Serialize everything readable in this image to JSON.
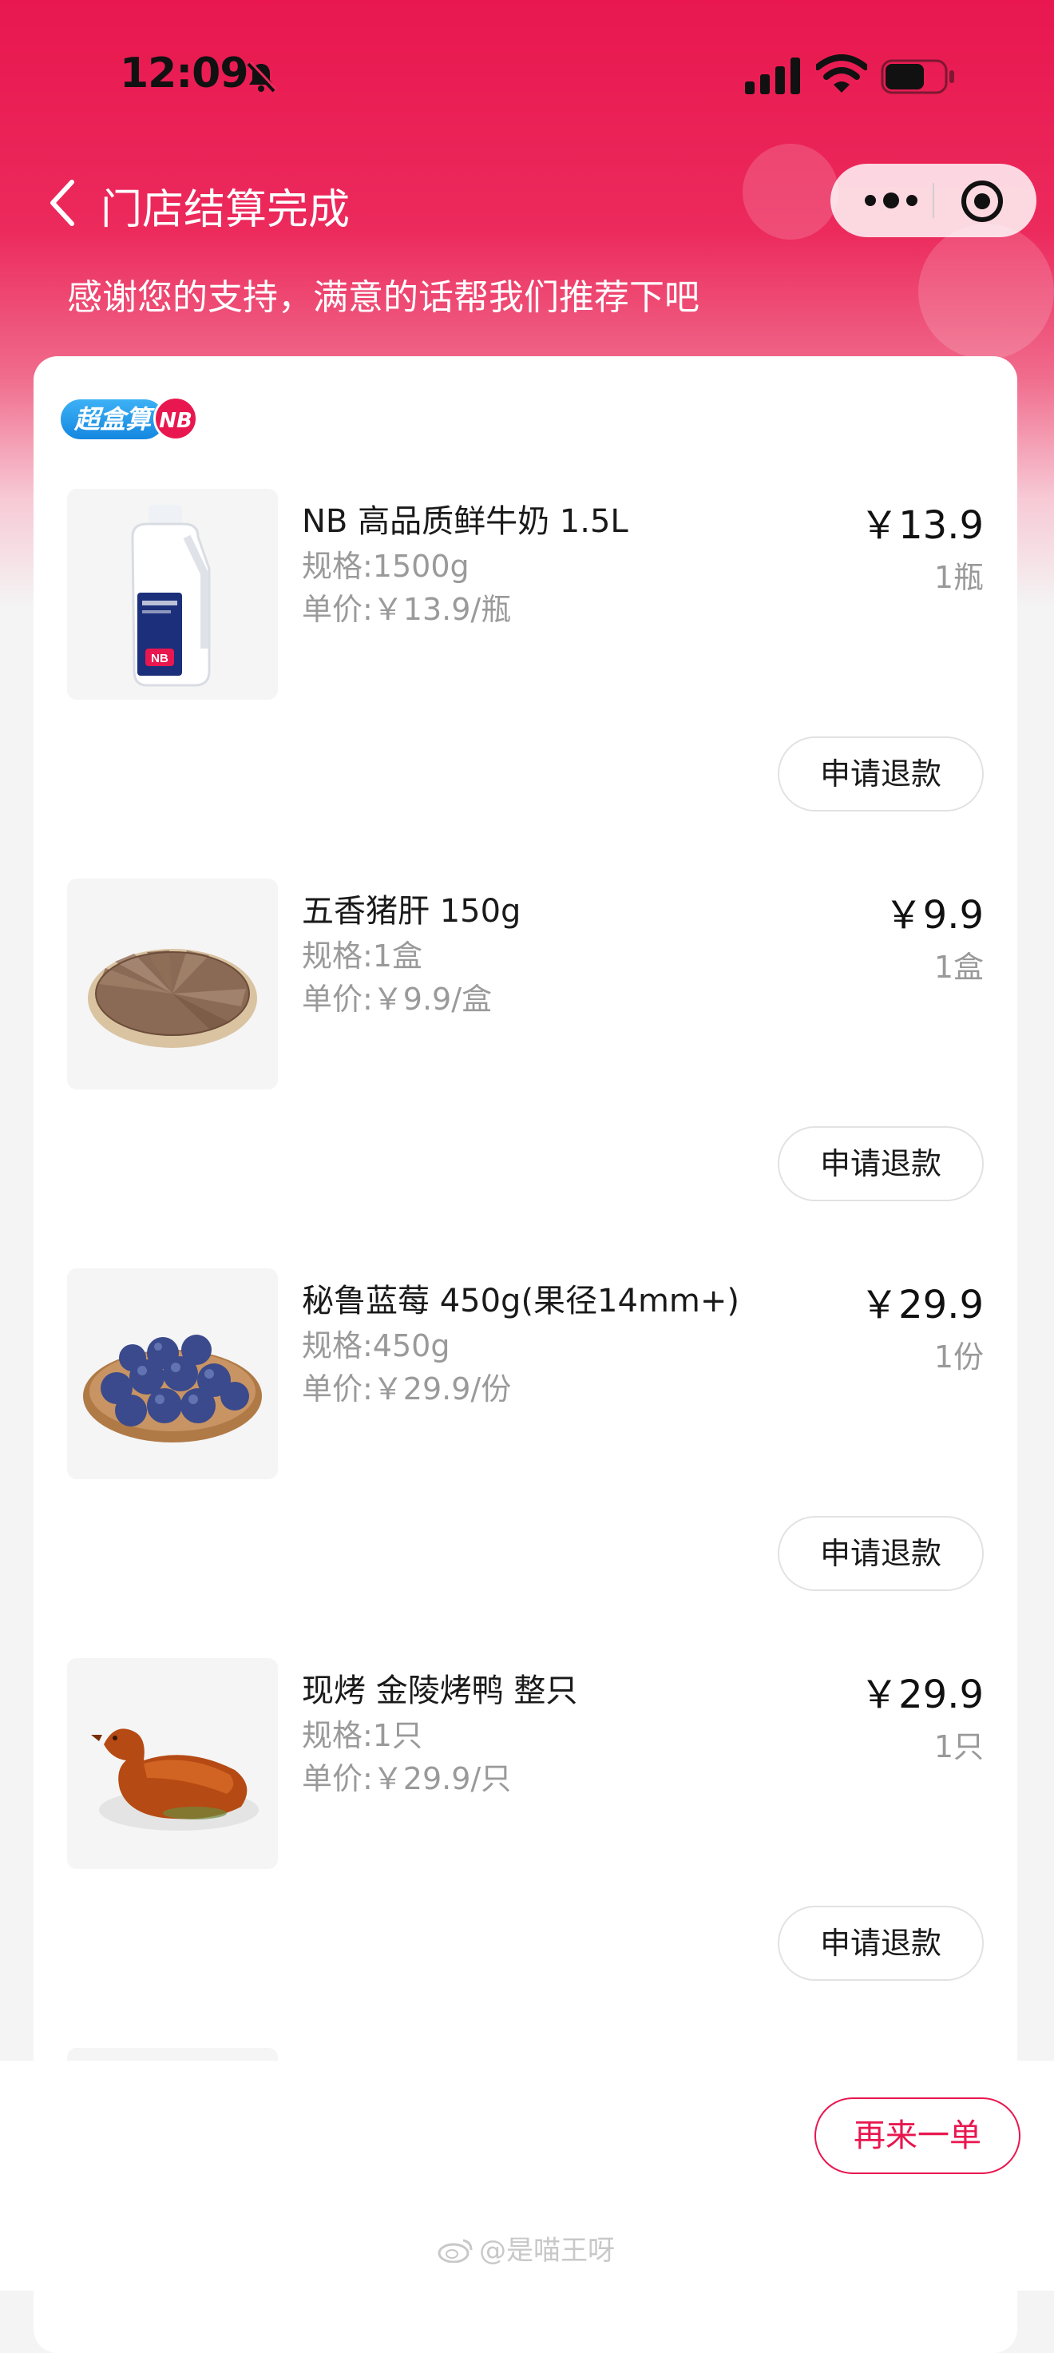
{
  "status_bar": {
    "time": "12:09",
    "icons": [
      "bell-slash-icon",
      "cellular-signal-icon",
      "wifi-icon",
      "battery-icon"
    ]
  },
  "nav": {
    "title": "门店结算完成",
    "subtitle": "感谢您的支持，满意的话帮我们推荐下吧",
    "back_icon": "chevron-left-icon",
    "capsule_icons": [
      "more-dots-icon",
      "target-circle-icon"
    ]
  },
  "brand": {
    "logo_text": "超盒算",
    "badge_text": "NB"
  },
  "items": [
    {
      "name": "NB 高品质鲜牛奶 1.5L",
      "spec": "规格:1500g",
      "unit_price": "单价:￥13.9/瓶",
      "price": "￥13.9",
      "qty": "1瓶",
      "refund_label": "申请退款",
      "image": "milk-bottle"
    },
    {
      "name": "五香猪肝 150g",
      "spec": "规格:1盒",
      "unit_price": "单价:￥9.9/盒",
      "price": "￥9.9",
      "qty": "1盒",
      "refund_label": "申请退款",
      "image": "sliced-pork-liver"
    },
    {
      "name": "秘鲁蓝莓 450g(果径14mm+)",
      "spec": "规格:450g",
      "unit_price": "单价:￥29.9/份",
      "price": "￥29.9",
      "qty": "1份",
      "refund_label": "申请退款",
      "image": "blueberries"
    },
    {
      "name": "现烤 金陵烤鸭 整只",
      "spec": "规格:1只",
      "unit_price": "单价:￥29.9/只",
      "price": "￥29.9",
      "qty": "1只",
      "refund_label": "申请退款",
      "image": "roast-duck"
    }
  ],
  "bottom": {
    "reorder_label": "再来一单"
  },
  "watermark": "@是喵王呀",
  "colors": {
    "brand_red": "#e8174f",
    "brand_blue": "#1587e0",
    "muted_text": "#9a9a9a"
  }
}
